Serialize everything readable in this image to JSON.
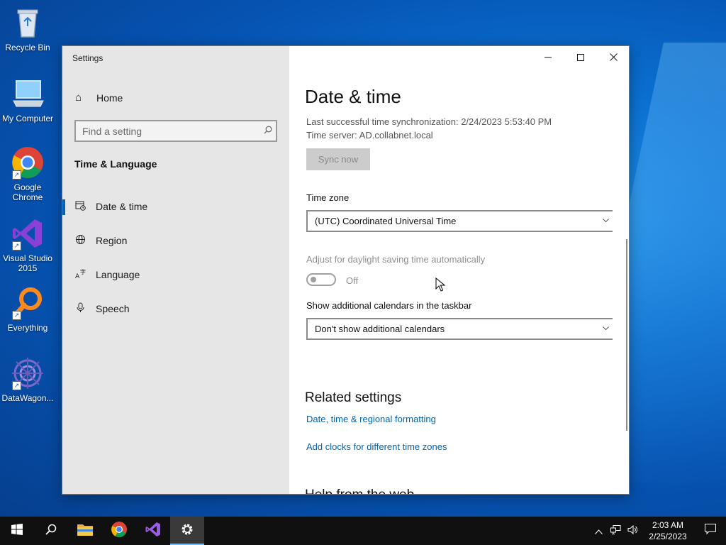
{
  "desktop": {
    "icons": [
      {
        "label": "Recycle Bin",
        "icon": "recycle-bin-icon"
      },
      {
        "label": "My Computer",
        "icon": "computer-icon"
      },
      {
        "label": "Google Chrome",
        "icon": "chrome-icon"
      },
      {
        "label": "Visual Studio 2015",
        "icon": "visual-studio-icon"
      },
      {
        "label": "Everything",
        "icon": "everything-search-icon"
      },
      {
        "label": "DataWagon...",
        "icon": "datawagon-icon"
      }
    ]
  },
  "window": {
    "title": "Settings",
    "controls": {
      "minimize": "minimize-icon",
      "maximize": "maximize-icon",
      "close": "close-icon"
    }
  },
  "sidebar": {
    "home_label": "Home",
    "search_placeholder": "Find a setting",
    "section_title": "Time & Language",
    "items": [
      {
        "label": "Date & time",
        "icon": "calendar-clock-icon",
        "active": true
      },
      {
        "label": "Region",
        "icon": "globe-icon",
        "active": false
      },
      {
        "label": "Language",
        "icon": "language-icon",
        "active": false
      },
      {
        "label": "Speech",
        "icon": "microphone-icon",
        "active": false
      }
    ]
  },
  "main": {
    "title": "Date & time",
    "sync_info": "Last successful time synchronization: 2/24/2023 5:53:40 PM",
    "time_server": "Time server: AD.collabnet.local",
    "sync_button": "Sync now",
    "time_zone_label": "Time zone",
    "time_zone_value": "(UTC) Coordinated Universal Time",
    "dst_label": "Adjust for daylight saving time automatically",
    "dst_state": "Off",
    "calendars_label": "Show additional calendars in the taskbar",
    "calendars_value": "Don't show additional calendars",
    "related_title": "Related settings",
    "related_links": [
      "Date, time & regional formatting",
      "Add clocks for different time zones"
    ],
    "next_section_peek": "Help from the web"
  },
  "taskbar": {
    "apps": [
      "start-icon",
      "search-icon",
      "file-explorer-icon",
      "chrome-icon",
      "visual-studio-icon",
      "settings-gear-icon"
    ],
    "active_app": "settings-gear-icon",
    "clock_time": "2:03 AM",
    "clock_date": "2/25/2023"
  },
  "colors": {
    "accent": "#0063b1",
    "taskbar": "#101010",
    "sidebar": "#e6e6e6"
  }
}
